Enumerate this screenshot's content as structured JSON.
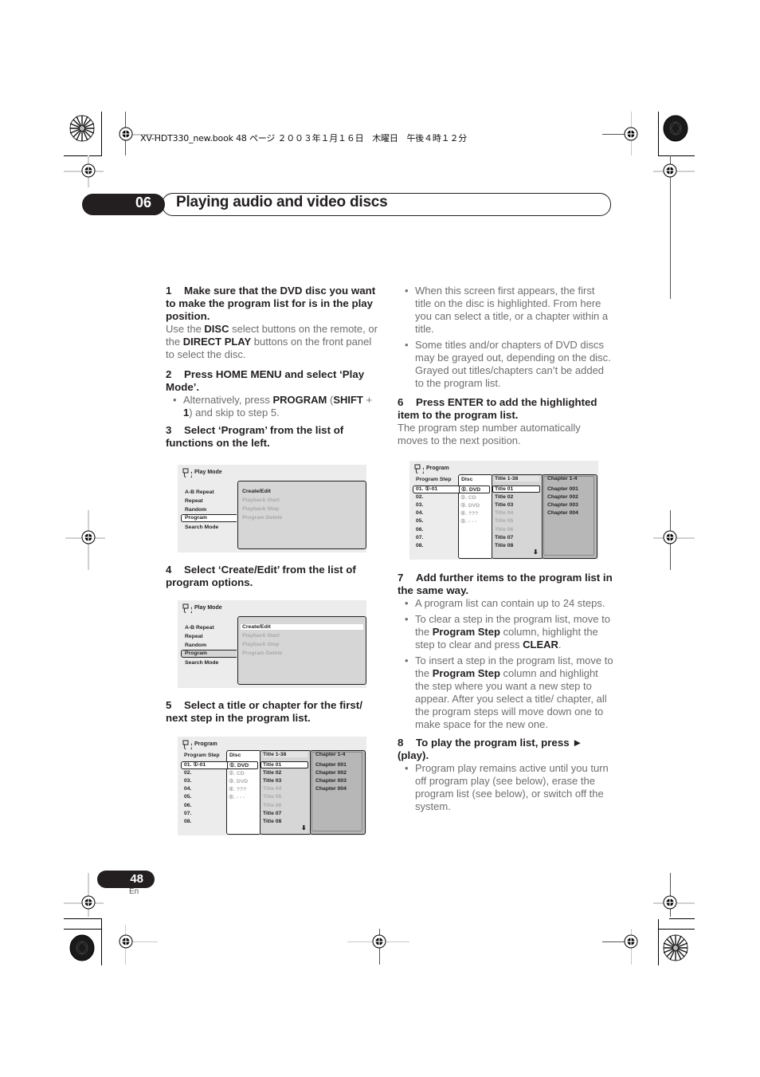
{
  "print_header": "XV-HDT330_new.book  48 ページ  ２００３年１月１６日　木曜日　午後４時１２分",
  "chapter": {
    "number": "06",
    "title": "Playing audio and video discs"
  },
  "left_column": {
    "step1": {
      "num": "1",
      "heading": "Make sure that the DVD disc you want to make the program list for is in the play position.",
      "body_pre": "Use the ",
      "body_b1": "DISC",
      "body_mid": " select buttons on the remote, or the ",
      "body_b2": "DIRECT PLAY",
      "body_post": " buttons on the front panel to select the disc."
    },
    "step2": {
      "num": "2",
      "heading": "Press HOME MENU and select ‘Play Mode’.",
      "bullet_pre": "Alternatively, press ",
      "bullet_b1": "PROGRAM",
      "bullet_mid1": " (",
      "bullet_b2": "SHIFT",
      "bullet_mid2": " + ",
      "bullet_b3": "1",
      "bullet_post": ") and skip to step 5."
    },
    "step3": {
      "num": "3",
      "heading": "Select ‘Program’ from the list of functions on the left."
    },
    "step4": {
      "num": "4",
      "heading": "Select ‘Create/Edit’ from the list of program options."
    },
    "step5": {
      "num": "5",
      "heading": "Select a title or chapter for the first/ next step in the program list."
    }
  },
  "right_column": {
    "bullets_a": [
      "When this screen first appears, the first title on the disc is highlighted. From here you can select a title, or a chapter within a title.",
      "Some titles and/or chapters of DVD discs may be grayed out, depending on the disc. Grayed out titles/chapters can’t be added to the program list."
    ],
    "step6": {
      "num": "6",
      "heading": "Press ENTER to add the highlighted item to the program list.",
      "body": "The program step number automatically moves to the next position."
    },
    "step7": {
      "num": "7",
      "heading": "Add further items to the program list in the same way.",
      "bullet1": "A program list can contain up to 24 steps.",
      "bullet2_pre": "To clear a step in the program list, move to the ",
      "bullet2_b1": "Program Step",
      "bullet2_mid": " column, highlight the step to clear and press ",
      "bullet2_b2": "CLEAR",
      "bullet2_post": ".",
      "bullet3_pre": "To insert a step in the program list, move to the ",
      "bullet3_b1": "Program Step",
      "bullet3_post": " column and highlight the step where you want a new step to appear. After you select a title/ chapter, all the program steps will move down one to make space for the new one."
    },
    "step8": {
      "num": "8",
      "heading": "To play the program list, press ► (play).",
      "bullet1": "Program play remains active until you turn off program play (see below), erase the program list (see below), or switch off the system."
    }
  },
  "screens": {
    "play_mode": {
      "title": "Play Mode",
      "functions": [
        "A-B Repeat",
        "Repeat",
        "Random",
        "Program",
        "Search Mode"
      ],
      "selected_function": "Program",
      "options": [
        "Create/Edit",
        "Playback Start",
        "Playback Stop",
        "Program Delete"
      ]
    },
    "program": {
      "title": "Program",
      "headers": {
        "step": "Program Step",
        "disc": "Disc",
        "title": "Title 1-38",
        "chapter": "Chapter 1-4"
      },
      "steps": [
        "01. ①-01",
        "02.",
        "03.",
        "04.",
        "05.",
        "06.",
        "07.",
        "08."
      ],
      "discs": [
        "①. DVD",
        "②. CD",
        "③. DVD",
        "④. ???",
        "⑤. - - -"
      ],
      "titles": [
        "Title 01",
        "Title 02",
        "Title 03",
        "Title 04",
        "Title 05",
        "Title 06",
        "Title 07",
        "Title 08"
      ],
      "chapters": [
        "Chapter 001",
        "Chapter 002",
        "Chapter 003",
        "Chapter 004"
      ],
      "scroll_icon": "down-arrow-icon"
    }
  },
  "footer": {
    "page_number": "48",
    "language": "En"
  }
}
